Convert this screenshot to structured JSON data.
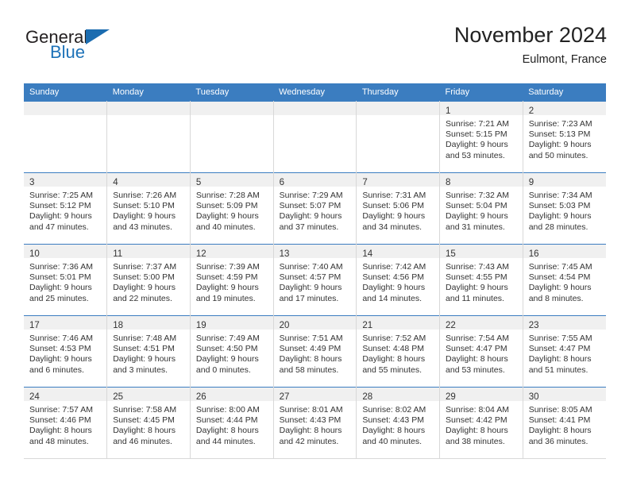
{
  "brand": {
    "name_part1": "General",
    "name_part2": "Blue",
    "triangle_icon": "brand-triangle-icon",
    "color_dark": "#231f20",
    "color_blue": "#1d72b8"
  },
  "header": {
    "title": "November 2024",
    "subtitle": "Eulmont, France"
  },
  "theme": {
    "header_blue": "#3b7dc0",
    "daynum_band": "#f0f0f0",
    "grid_line": "#d8d8d8",
    "text": "#333333"
  },
  "weekday_headers": [
    "Sunday",
    "Monday",
    "Tuesday",
    "Wednesday",
    "Thursday",
    "Friday",
    "Saturday"
  ],
  "labels": {
    "sunrise_prefix": "Sunrise:",
    "sunset_prefix": "Sunset:",
    "daylight_prefix": "Daylight:"
  },
  "weeks": [
    [
      {
        "empty": true
      },
      {
        "empty": true
      },
      {
        "empty": true
      },
      {
        "empty": true
      },
      {
        "empty": true
      },
      {
        "empty": false,
        "day": "1",
        "line1": "Sunrise: 7:21 AM",
        "line2": "Sunset: 5:15 PM",
        "line3": "Daylight: 9 hours",
        "line4": "and 53 minutes."
      },
      {
        "empty": false,
        "day": "2",
        "line1": "Sunrise: 7:23 AM",
        "line2": "Sunset: 5:13 PM",
        "line3": "Daylight: 9 hours",
        "line4": "and 50 minutes."
      }
    ],
    [
      {
        "empty": false,
        "day": "3",
        "line1": "Sunrise: 7:25 AM",
        "line2": "Sunset: 5:12 PM",
        "line3": "Daylight: 9 hours",
        "line4": "and 47 minutes."
      },
      {
        "empty": false,
        "day": "4",
        "line1": "Sunrise: 7:26 AM",
        "line2": "Sunset: 5:10 PM",
        "line3": "Daylight: 9 hours",
        "line4": "and 43 minutes."
      },
      {
        "empty": false,
        "day": "5",
        "line1": "Sunrise: 7:28 AM",
        "line2": "Sunset: 5:09 PM",
        "line3": "Daylight: 9 hours",
        "line4": "and 40 minutes."
      },
      {
        "empty": false,
        "day": "6",
        "line1": "Sunrise: 7:29 AM",
        "line2": "Sunset: 5:07 PM",
        "line3": "Daylight: 9 hours",
        "line4": "and 37 minutes."
      },
      {
        "empty": false,
        "day": "7",
        "line1": "Sunrise: 7:31 AM",
        "line2": "Sunset: 5:06 PM",
        "line3": "Daylight: 9 hours",
        "line4": "and 34 minutes."
      },
      {
        "empty": false,
        "day": "8",
        "line1": "Sunrise: 7:32 AM",
        "line2": "Sunset: 5:04 PM",
        "line3": "Daylight: 9 hours",
        "line4": "and 31 minutes."
      },
      {
        "empty": false,
        "day": "9",
        "line1": "Sunrise: 7:34 AM",
        "line2": "Sunset: 5:03 PM",
        "line3": "Daylight: 9 hours",
        "line4": "and 28 minutes."
      }
    ],
    [
      {
        "empty": false,
        "day": "10",
        "line1": "Sunrise: 7:36 AM",
        "line2": "Sunset: 5:01 PM",
        "line3": "Daylight: 9 hours",
        "line4": "and 25 minutes."
      },
      {
        "empty": false,
        "day": "11",
        "line1": "Sunrise: 7:37 AM",
        "line2": "Sunset: 5:00 PM",
        "line3": "Daylight: 9 hours",
        "line4": "and 22 minutes."
      },
      {
        "empty": false,
        "day": "12",
        "line1": "Sunrise: 7:39 AM",
        "line2": "Sunset: 4:59 PM",
        "line3": "Daylight: 9 hours",
        "line4": "and 19 minutes."
      },
      {
        "empty": false,
        "day": "13",
        "line1": "Sunrise: 7:40 AM",
        "line2": "Sunset: 4:57 PM",
        "line3": "Daylight: 9 hours",
        "line4": "and 17 minutes."
      },
      {
        "empty": false,
        "day": "14",
        "line1": "Sunrise: 7:42 AM",
        "line2": "Sunset: 4:56 PM",
        "line3": "Daylight: 9 hours",
        "line4": "and 14 minutes."
      },
      {
        "empty": false,
        "day": "15",
        "line1": "Sunrise: 7:43 AM",
        "line2": "Sunset: 4:55 PM",
        "line3": "Daylight: 9 hours",
        "line4": "and 11 minutes."
      },
      {
        "empty": false,
        "day": "16",
        "line1": "Sunrise: 7:45 AM",
        "line2": "Sunset: 4:54 PM",
        "line3": "Daylight: 9 hours",
        "line4": "and 8 minutes."
      }
    ],
    [
      {
        "empty": false,
        "day": "17",
        "line1": "Sunrise: 7:46 AM",
        "line2": "Sunset: 4:53 PM",
        "line3": "Daylight: 9 hours",
        "line4": "and 6 minutes."
      },
      {
        "empty": false,
        "day": "18",
        "line1": "Sunrise: 7:48 AM",
        "line2": "Sunset: 4:51 PM",
        "line3": "Daylight: 9 hours",
        "line4": "and 3 minutes."
      },
      {
        "empty": false,
        "day": "19",
        "line1": "Sunrise: 7:49 AM",
        "line2": "Sunset: 4:50 PM",
        "line3": "Daylight: 9 hours",
        "line4": "and 0 minutes."
      },
      {
        "empty": false,
        "day": "20",
        "line1": "Sunrise: 7:51 AM",
        "line2": "Sunset: 4:49 PM",
        "line3": "Daylight: 8 hours",
        "line4": "and 58 minutes."
      },
      {
        "empty": false,
        "day": "21",
        "line1": "Sunrise: 7:52 AM",
        "line2": "Sunset: 4:48 PM",
        "line3": "Daylight: 8 hours",
        "line4": "and 55 minutes."
      },
      {
        "empty": false,
        "day": "22",
        "line1": "Sunrise: 7:54 AM",
        "line2": "Sunset: 4:47 PM",
        "line3": "Daylight: 8 hours",
        "line4": "and 53 minutes."
      },
      {
        "empty": false,
        "day": "23",
        "line1": "Sunrise: 7:55 AM",
        "line2": "Sunset: 4:47 PM",
        "line3": "Daylight: 8 hours",
        "line4": "and 51 minutes."
      }
    ],
    [
      {
        "empty": false,
        "day": "24",
        "line1": "Sunrise: 7:57 AM",
        "line2": "Sunset: 4:46 PM",
        "line3": "Daylight: 8 hours",
        "line4": "and 48 minutes."
      },
      {
        "empty": false,
        "day": "25",
        "line1": "Sunrise: 7:58 AM",
        "line2": "Sunset: 4:45 PM",
        "line3": "Daylight: 8 hours",
        "line4": "and 46 minutes."
      },
      {
        "empty": false,
        "day": "26",
        "line1": "Sunrise: 8:00 AM",
        "line2": "Sunset: 4:44 PM",
        "line3": "Daylight: 8 hours",
        "line4": "and 44 minutes."
      },
      {
        "empty": false,
        "day": "27",
        "line1": "Sunrise: 8:01 AM",
        "line2": "Sunset: 4:43 PM",
        "line3": "Daylight: 8 hours",
        "line4": "and 42 minutes."
      },
      {
        "empty": false,
        "day": "28",
        "line1": "Sunrise: 8:02 AM",
        "line2": "Sunset: 4:43 PM",
        "line3": "Daylight: 8 hours",
        "line4": "and 40 minutes."
      },
      {
        "empty": false,
        "day": "29",
        "line1": "Sunrise: 8:04 AM",
        "line2": "Sunset: 4:42 PM",
        "line3": "Daylight: 8 hours",
        "line4": "and 38 minutes."
      },
      {
        "empty": false,
        "day": "30",
        "line1": "Sunrise: 8:05 AM",
        "line2": "Sunset: 4:41 PM",
        "line3": "Daylight: 8 hours",
        "line4": "and 36 minutes."
      }
    ]
  ]
}
